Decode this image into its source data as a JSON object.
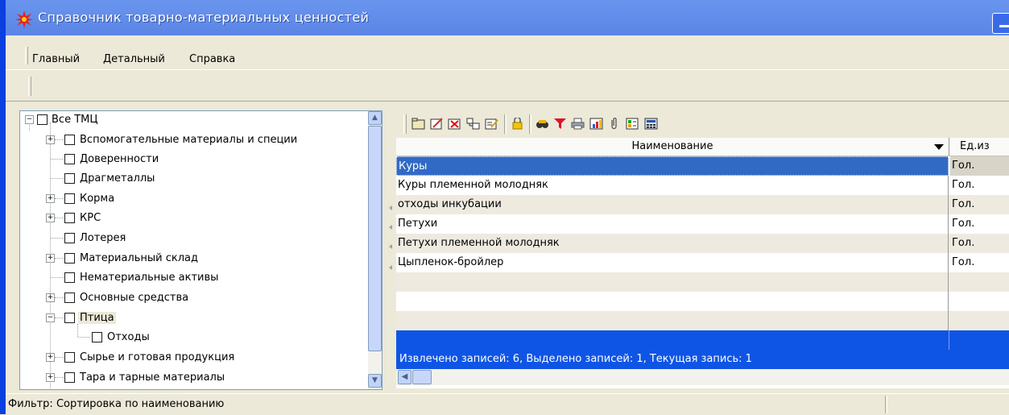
{
  "window": {
    "title": "Справочник товарно-материальных ценностей"
  },
  "menu": {
    "items": [
      "Главный",
      "Детальный",
      "Справка"
    ]
  },
  "tree": {
    "items": [
      {
        "label": "Все ТМЦ",
        "expander": "minus"
      },
      {
        "label": "Вспомогательные материалы и специи",
        "expander": "plus"
      },
      {
        "label": "Доверенности",
        "expander": "none"
      },
      {
        "label": "Драгметаллы",
        "expander": "none"
      },
      {
        "label": "Корма",
        "expander": "plus"
      },
      {
        "label": "КРС",
        "expander": "plus"
      },
      {
        "label": "Лотерея",
        "expander": "none"
      },
      {
        "label": "Материальный склад",
        "expander": "plus"
      },
      {
        "label": "Нематериальные активы",
        "expander": "none"
      },
      {
        "label": "Основные средства",
        "expander": "plus"
      },
      {
        "label": "Птица",
        "expander": "minus",
        "selected": true
      },
      {
        "label": "Отходы",
        "expander": "none"
      },
      {
        "label": "Сырье и готовая продукция",
        "expander": "plus"
      },
      {
        "label": "Тара и тарные материалы",
        "expander": "plus"
      }
    ]
  },
  "toolbar": {
    "icons": [
      "folder-icon",
      "edit-icon",
      "delete-icon",
      "copy-tree-icon",
      "edit-list-icon",
      "lock-icon",
      "binoculars-icon",
      "filter-icon",
      "print-icon",
      "chart-icon",
      "paperclip-icon",
      "checklist-icon",
      "calculator-icon"
    ]
  },
  "grid": {
    "columns": [
      "Наименование",
      "Ед.из"
    ],
    "rows": [
      {
        "name": "Куры",
        "unit": "Гол."
      },
      {
        "name": "Куры племенной молодняк",
        "unit": "Гол."
      },
      {
        "name": "отходы инкубации",
        "unit": "Гол."
      },
      {
        "name": "Петухи",
        "unit": "Гол."
      },
      {
        "name": "Петухи племенной молодняк",
        "unit": "Гол."
      },
      {
        "name": "Цыпленок-бройлер",
        "unit": "Гол."
      }
    ],
    "summary": "Извлечено записей: 6, Выделено записей: 1, Текущая запись: 1"
  },
  "status": {
    "text": "Фильтр: Сортировка по наименованию"
  },
  "colors": {
    "title_bar": "#5a85e6",
    "selection": "#316ac5",
    "summary_bar": "#0f55e5",
    "filter_icon": "#e0102a"
  }
}
